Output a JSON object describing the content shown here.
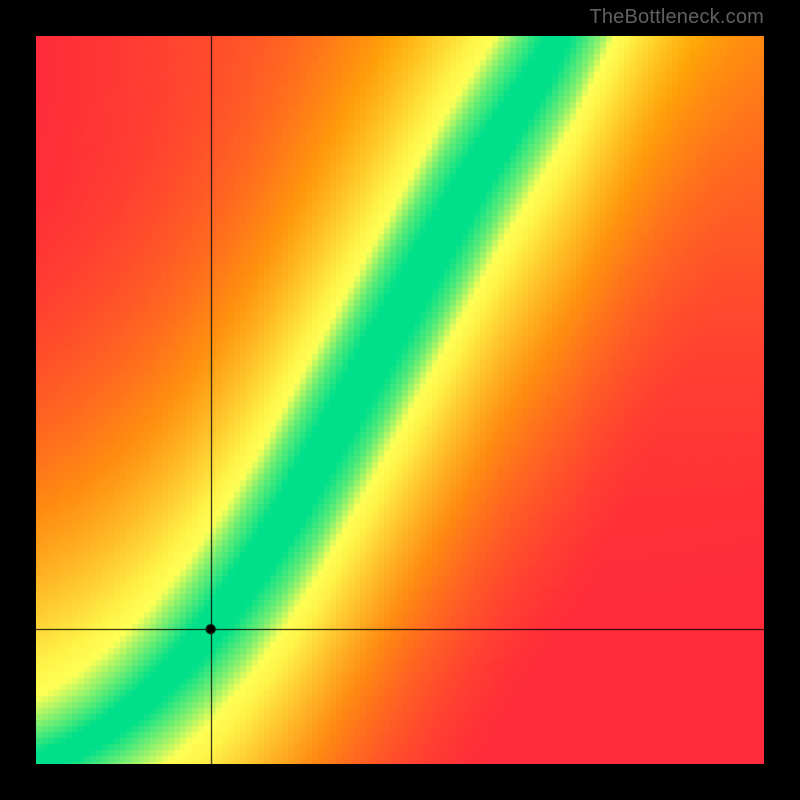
{
  "watermark": {
    "text": "TheBottleneck.com"
  },
  "colors": {
    "background_frame": "#000000",
    "gradient_tl": "#ff2a3a",
    "gradient_tr": "#ffb400",
    "gradient_bl": "#ff2a3a",
    "gradient_br": "#ff2a3a",
    "band_center": "#00e08a",
    "band_mid": "#ffff55",
    "crosshair": "#000000",
    "marker": "#000000"
  },
  "chart_data": {
    "type": "heatmap",
    "title": "",
    "xlabel": "",
    "ylabel": "",
    "xlim": [
      0,
      1
    ],
    "ylim": [
      0,
      1
    ],
    "marker": {
      "x": 0.24,
      "y": 0.185
    },
    "crosshair": {
      "x": 0.24,
      "y": 0.185
    },
    "optimal_curve": {
      "description": "Green optimal band roughly follows y = x^1.5 from origin, curving upward; band width narrows toward the top-right.",
      "points_x": [
        0.0,
        0.05,
        0.1,
        0.15,
        0.2,
        0.25,
        0.3,
        0.35,
        0.4,
        0.45,
        0.5,
        0.55,
        0.6,
        0.65,
        0.7,
        0.72
      ],
      "points_y": [
        0.0,
        0.02,
        0.05,
        0.09,
        0.14,
        0.2,
        0.27,
        0.35,
        0.44,
        0.53,
        0.62,
        0.71,
        0.8,
        0.88,
        0.96,
        1.0
      ],
      "band_half_width": [
        0.02,
        0.021,
        0.023,
        0.025,
        0.027,
        0.03,
        0.032,
        0.034,
        0.036,
        0.038,
        0.038,
        0.037,
        0.035,
        0.032,
        0.028,
        0.025
      ]
    },
    "color_scale": {
      "description": "Distance from optimal curve: 0 → green, growing → yellow → orange → red. Background has a secondary warm gradient brighter toward top-right.",
      "stops": [
        {
          "t": 0.0,
          "color": "#00e08a"
        },
        {
          "t": 0.08,
          "color": "#ffff55"
        },
        {
          "t": 0.35,
          "color": "#ffb400"
        },
        {
          "t": 1.0,
          "color": "#ff2a3a"
        }
      ]
    },
    "pixelation": 6
  }
}
